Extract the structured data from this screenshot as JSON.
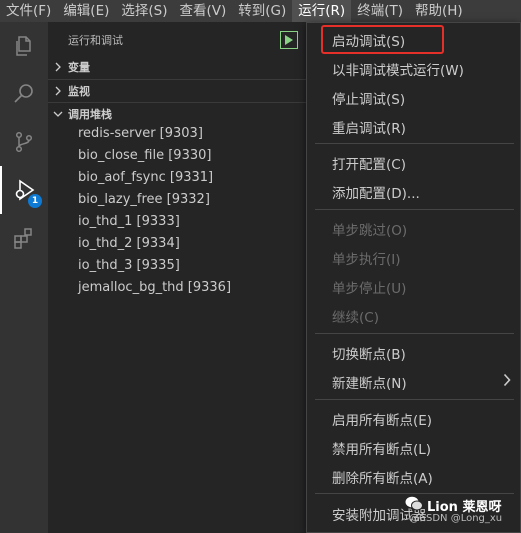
{
  "menubar": {
    "items": [
      "文件(F)",
      "编辑(E)",
      "选择(S)",
      "查看(V)",
      "转到(G)",
      "运行(R)",
      "终端(T)",
      "帮助(H)"
    ],
    "active_index": 5
  },
  "activitybar": {
    "icons": [
      "explorer-icon",
      "search-icon",
      "source-control-icon",
      "run-debug-icon",
      "extensions-icon"
    ],
    "active": "run-debug-icon",
    "debug_badge": "1",
    "accent_color": "#0e7ad3"
  },
  "sidebar": {
    "title": "运行和调试",
    "sections": {
      "variables": "变量",
      "watch": "监视",
      "call_stack": "调用堆栈"
    },
    "threads": [
      "redis-server [9303]",
      "bio_close_file [9330]",
      "bio_aof_fsync [9331]",
      "bio_lazy_free [9332]",
      "io_thd_1 [9333]",
      "io_thd_2 [9334]",
      "io_thd_3 [9335]",
      "jemalloc_bg_thd [9336]"
    ]
  },
  "run_menu": {
    "items": [
      {
        "label": "启动调试(S)",
        "enabled": true,
        "highlighted": true
      },
      {
        "label": "以非调试模式运行(W)",
        "enabled": true
      },
      {
        "label": "停止调试(S)",
        "enabled": true
      },
      {
        "label": "重启调试(R)",
        "enabled": true
      },
      {
        "label": "打开配置(C)",
        "enabled": true
      },
      {
        "label": "添加配置(D)...",
        "enabled": true
      },
      {
        "label": "单步跳过(O)",
        "enabled": false
      },
      {
        "label": "单步执行(I)",
        "enabled": false
      },
      {
        "label": "单步停止(U)",
        "enabled": false
      },
      {
        "label": "继续(C)",
        "enabled": false
      },
      {
        "label": "切换断点(B)",
        "enabled": true
      },
      {
        "label": "新建断点(N)",
        "enabled": true,
        "submenu": true
      },
      {
        "label": "启用所有断点(E)",
        "enabled": true
      },
      {
        "label": "禁用所有断点(L)",
        "enabled": true
      },
      {
        "label": "删除所有断点(A)",
        "enabled": true
      },
      {
        "label": "安装附加调试器",
        "enabled": true
      }
    ],
    "highlight_color": "#e5302a"
  },
  "watermark": {
    "title": "Lion 莱恩呀",
    "subtitle": "@CSDN @Long_xu"
  }
}
